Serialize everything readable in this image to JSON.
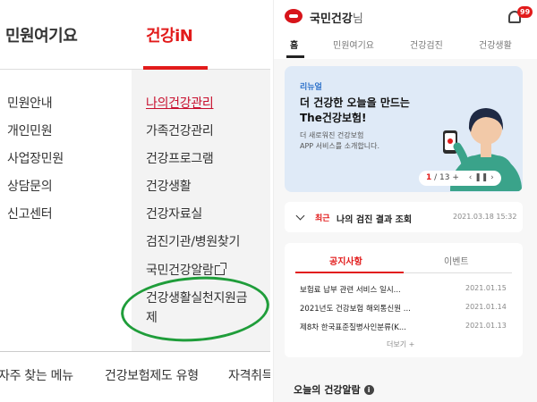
{
  "left": {
    "tabs": [
      {
        "label": "민원여기요"
      },
      {
        "label": "건강iN"
      }
    ],
    "col1": [
      "민원안내",
      "개인민원",
      "사업장민원",
      "상담문의",
      "신고센터"
    ],
    "col2": [
      "나의건강관리",
      "가족건강관리",
      "건강프로그램",
      "건강생활",
      "건강자료실",
      "검진기관/병원찾기",
      "국민건강알람",
      "건강생활실천지원금",
      "제"
    ],
    "footer": [
      "자주 찾는 메뉴",
      "건강보험제도 유형",
      "자격취득"
    ]
  },
  "right": {
    "user": {
      "name": "국민건강",
      "suffix": "님"
    },
    "badge": "99",
    "tabs": [
      "홈",
      "민원여기요",
      "건강검진",
      "건강생활"
    ],
    "banner": {
      "tag": "리뉴얼",
      "title1": "더 건강한 오늘을 만드는",
      "title2": "The건강보험!",
      "desc1": "더 새로워진 건강보험",
      "desc2": "APP 서비스를 소개합니다.",
      "page_current": "1",
      "page_total": "/ 13 +",
      "controls": "‹  ❚❚  ›"
    },
    "checkup": {
      "recent": "최근",
      "title": "나의 검진 결과 조회",
      "date": "2021.03.18 15:32"
    },
    "notice": {
      "tab_active": "공지사항",
      "tab_inactive": "이벤트",
      "rows": [
        {
          "title": "보험료 납부 관련 서비스 일시...",
          "date": "2021.01.15"
        },
        {
          "title": "2021년도 건강보험 해외통신원 ...",
          "date": "2021.01.14"
        },
        {
          "title": "제8차 한국표준질병사인분류(K...",
          "date": "2021.01.13"
        }
      ],
      "more": "더보기 +"
    },
    "alarm_title": "오늘의 건강알람"
  },
  "colors": {
    "accent": "#e21b1b",
    "active_link": "#c8102e",
    "ellipse": "#1f9d3a",
    "banner_bg": "#dfeaf7"
  },
  "icons": [
    "logo-icon",
    "bell-icon",
    "external-link-icon",
    "chevron-down-icon",
    "info-icon"
  ]
}
